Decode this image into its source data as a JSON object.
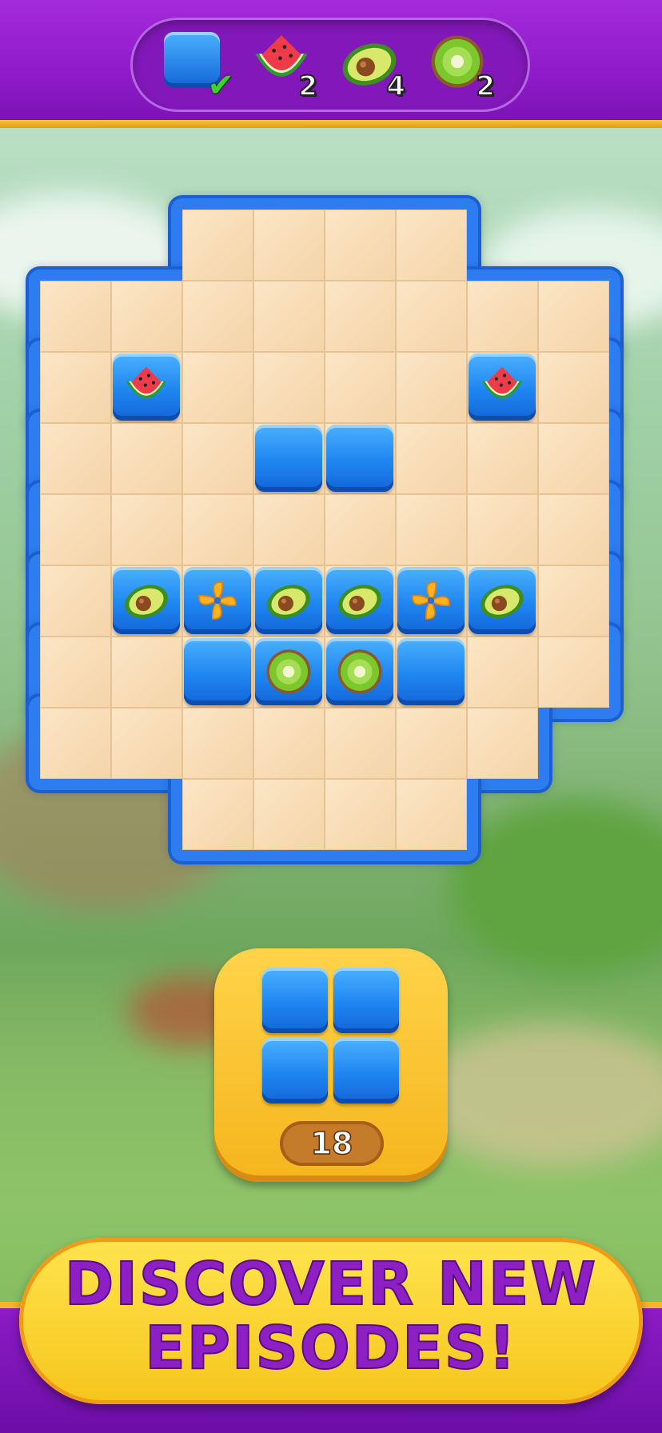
{
  "goals": [
    {
      "icon": "blue-block-icon",
      "status": "complete",
      "count": ""
    },
    {
      "icon": "watermelon-icon",
      "count": "2"
    },
    {
      "icon": "avocado-icon",
      "count": "4"
    },
    {
      "icon": "kiwi-icon",
      "count": "2"
    }
  ],
  "board": {
    "rows": [
      "..0000..",
      "00000000",
      "0W0000W0",
      "000BB000",
      "00000000",
      "0APAAPA0",
      "00BKKB00",
      "0000000.",
      "..0000.."
    ],
    "legend": {
      "0": "empty",
      "B": "blue-block",
      "W": "watermelon",
      "A": "avocado",
      "P": "pinwheel",
      "K": "kiwi",
      ".": "none"
    }
  },
  "next_piece": {
    "shape": "2x2 square",
    "color": "#1f86f1"
  },
  "moves_left": "18",
  "banner": {
    "line1": "DISCOVER NEW",
    "line2": "EPISODES!"
  },
  "colors": {
    "purple": "#8d1bc7",
    "block_blue": "#1f86f1",
    "tile": "#f5d4a8",
    "banner_yellow": "#ffd934"
  }
}
